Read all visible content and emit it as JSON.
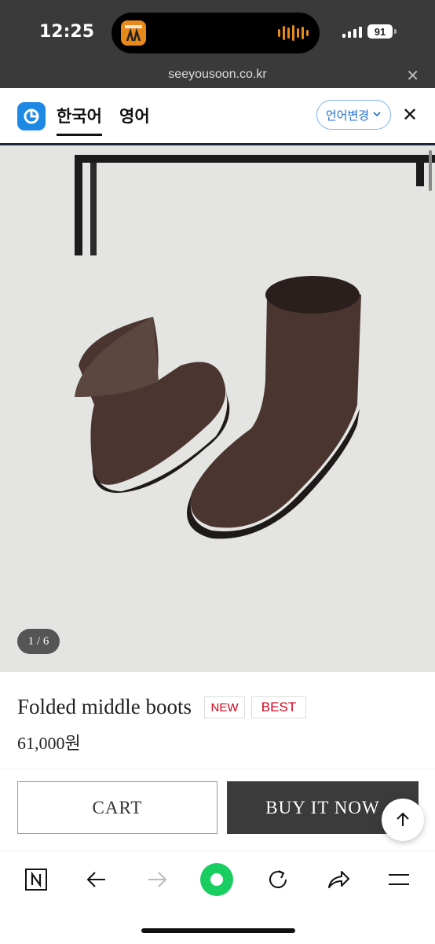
{
  "status_bar": {
    "time": "12:25",
    "battery": "91"
  },
  "browser": {
    "url": "seeyousoon.co.kr",
    "close_icon": "close-icon"
  },
  "translate_bar": {
    "tabs": [
      "한국어",
      "영어"
    ],
    "change_button": "언어변경",
    "accent": "#1e6fd9"
  },
  "product": {
    "image_counter": "1 / 6",
    "name": "Folded middle boots",
    "badges": [
      "NEW",
      "BEST"
    ],
    "price": "61,000원",
    "badge_color": "#d0021b"
  },
  "actions": {
    "cart": "CART",
    "buy": "BUY IT NOW"
  },
  "toolbar": {
    "icons": [
      "naver-n-icon",
      "back-arrow-icon",
      "forward-arrow-icon",
      "green-dot-icon",
      "refresh-icon",
      "share-icon",
      "menu-icon"
    ]
  }
}
